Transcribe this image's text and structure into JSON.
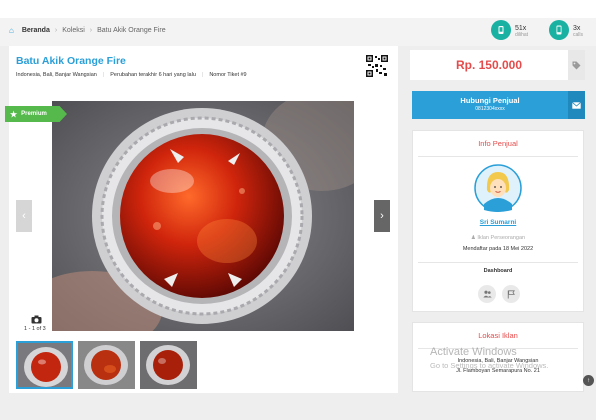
{
  "breadcrumb": {
    "home_icon": "home-icon",
    "items": [
      "Beranda",
      "Koleksi",
      "Batu Akik Orange Fire"
    ]
  },
  "stats": {
    "views": {
      "count": "51x",
      "label": "dilihat",
      "icon": "eye-icon"
    },
    "calls": {
      "count": "3x",
      "label": "calls",
      "icon": "phone-icon"
    }
  },
  "listing": {
    "title": "Batu Akik Orange Fire",
    "location": "Indonesia, Bali, Banjar Wangsian",
    "updated": "Perubahan terakhir 6 hari yang lalu",
    "ticket": "Nomor Tiket #9",
    "badge": "Premium",
    "gallery_counter": "1 - 1 of 3"
  },
  "price": {
    "value": "Rp. 150.000",
    "tag_icon": "tag-icon"
  },
  "contact": {
    "label": "Hubungi Penjual",
    "phone": "0812304xxxx",
    "mail_icon": "mail-icon"
  },
  "seller": {
    "heading": "Info Penjual",
    "name": "Sri Sumarni",
    "type": "Iklan Perseorangan",
    "since": "Mendaftar pada 18 Mei 2022",
    "dashboard_tab": "Dashboard"
  },
  "location_card": {
    "heading": "Lokasi Iklan",
    "line1": "Indonesia, Bali, Banjar Wangsian",
    "line2": "Jl. Flamboyan Semarapura No. 21"
  },
  "watermark": {
    "line1": "Activate Windows",
    "line2": "Go to Settings to activate Windows."
  },
  "colors": {
    "accent": "#2a9fd8",
    "price": "#e54b4b",
    "premium": "#56b94c",
    "stat_teal": "#18b1a2"
  }
}
